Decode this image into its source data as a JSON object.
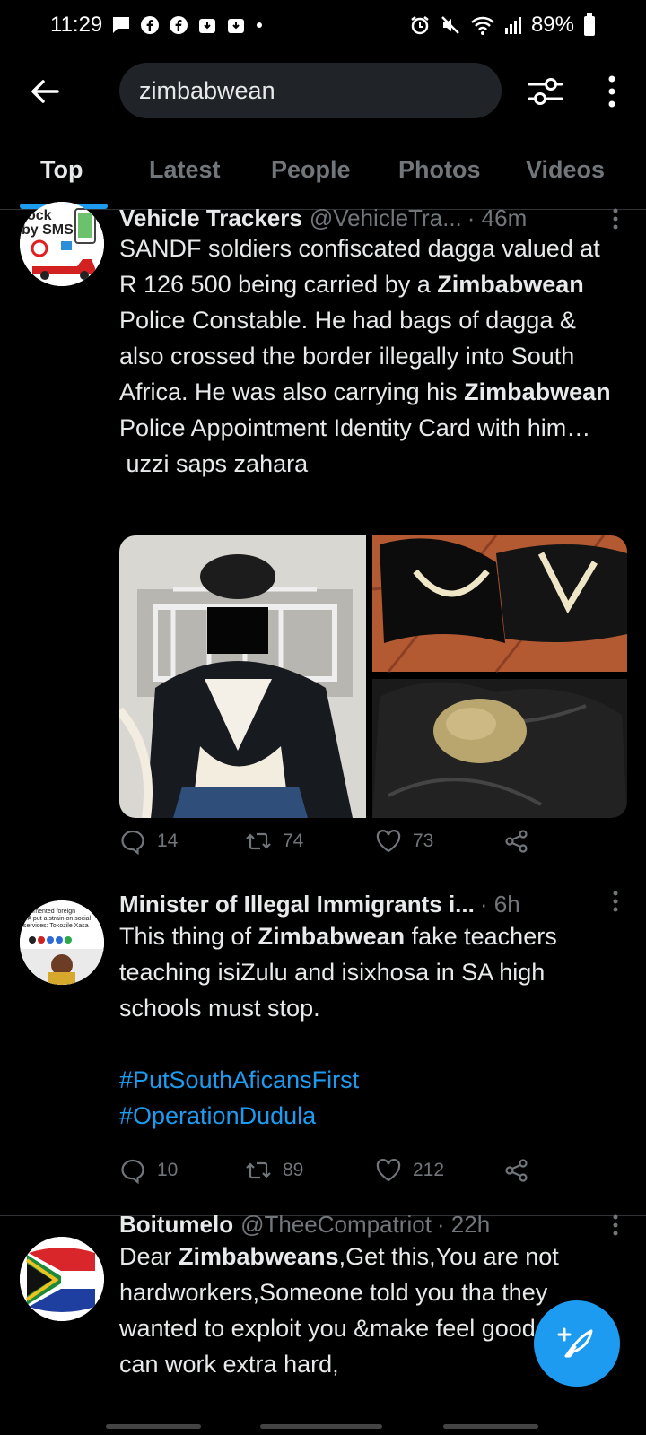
{
  "status_bar": {
    "time": "11:29",
    "battery": "89%"
  },
  "search": {
    "query": "zimbabwean"
  },
  "tabs": [
    {
      "label": "Top",
      "active": true
    },
    {
      "label": "Latest",
      "active": false
    },
    {
      "label": "People",
      "active": false
    },
    {
      "label": "Photos",
      "active": false
    },
    {
      "label": "Videos",
      "active": false
    }
  ],
  "tweets": [
    {
      "name": "Vehicle Trackers",
      "handle": "@VehicleTra...",
      "time": "· 46m",
      "body_html": "SANDF soldiers confiscated dagga valued at R 126 500 being carried by a <b>Zimbabwean</b> Police Constable. He had bags of dagga &amp; also crossed the border illegally into South Africa. He was also carrying his <b>Zimbabwean</b> Police Appointment Identity Card with him…<br>&nbsp;uzzi saps zahara",
      "replies": "14",
      "retweets": "74",
      "likes": "73"
    },
    {
      "name": "Minister of Illegal Immigrants i...",
      "handle": "",
      "time": "· 6h",
      "body_html": "This thing of <b>Zimbabwean</b> fake teachers teaching isiZulu and isixhosa in SA high schools must stop.",
      "hashtags": [
        "#PutSouthAficansFirst",
        "#OperationDudula"
      ],
      "replies": "10",
      "retweets": "89",
      "likes": "212"
    },
    {
      "name": "Boitumelo",
      "handle": "@TheeCompatriot",
      "time": "· 22h",
      "body_html": "Dear <b>Zimbabweans</b>,Get this,You are not hardworkers,Someone told you tha they wanted to exploit you &amp;make feel good so you can work extra hard,"
    }
  ],
  "avatar_text": {
    "t1": "ock by SMS",
    "t2": "ocumented foreign SA put a strain on social services: Tokozile Xasa"
  },
  "colors": {
    "accent": "#1d9bf0",
    "background": "#000000",
    "muted": "#71767b"
  }
}
